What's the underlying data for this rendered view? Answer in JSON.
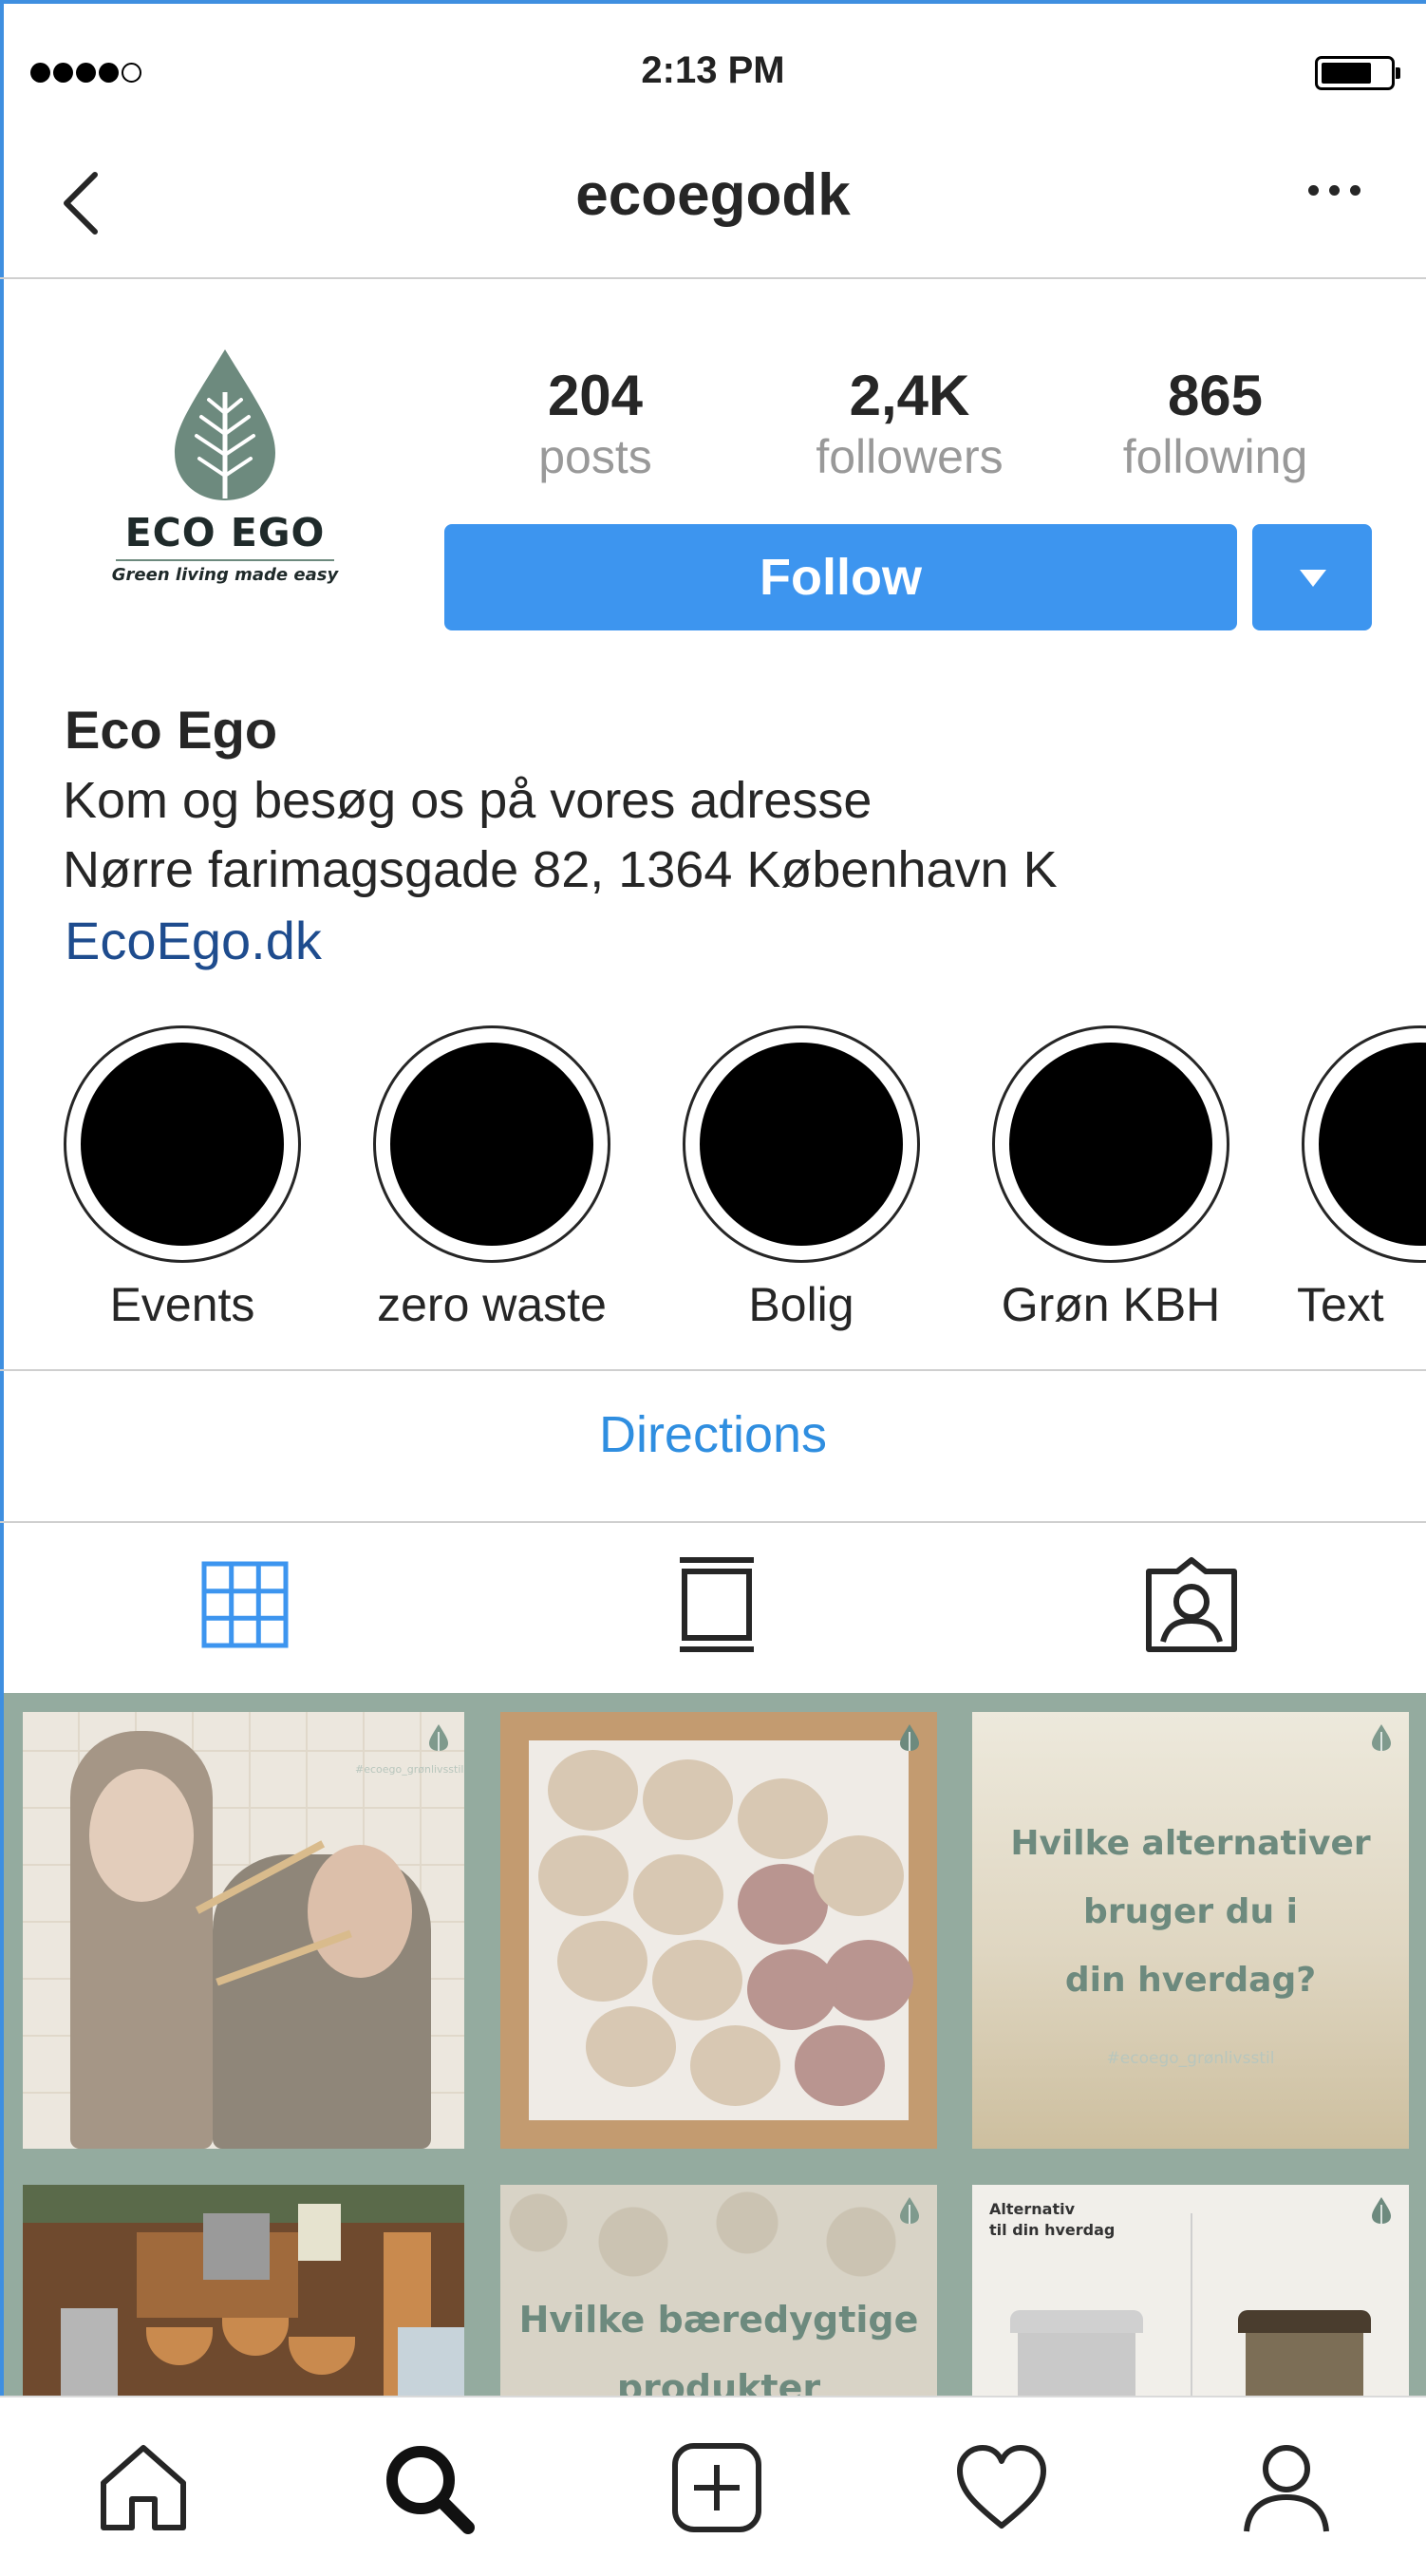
{
  "status_bar": {
    "time": "2:13 PM"
  },
  "nav": {
    "username": "ecoegodk"
  },
  "profile": {
    "logo_text": "ECO EGO",
    "logo_tagline": "Green living made easy",
    "stats": [
      {
        "value": "204",
        "label": "posts"
      },
      {
        "value": "2,4K",
        "label": "followers"
      },
      {
        "value": "865",
        "label": "following"
      }
    ],
    "follow_label": "Follow"
  },
  "bio": {
    "name": "Eco Ego",
    "lines": [
      "Kom og besøg os på vores adresse",
      "Nørre farimagsgade 82, 1364 København K"
    ],
    "link": "EcoEgo.dk"
  },
  "highlights": [
    {
      "label": "Events"
    },
    {
      "label": "zero waste"
    },
    {
      "label": "Bolig"
    },
    {
      "label": "Grøn KBH"
    },
    {
      "label": "Text"
    }
  ],
  "directions_label": "Directions",
  "tabs": {
    "grid": "grid-icon",
    "feed": "feed-icon",
    "tagged": "tagged-icon",
    "active": "grid"
  },
  "posts": {
    "p1_hashtag": "#ecoego_grønlivsstil",
    "p3_lines": [
      "Hvilke alternativer",
      "bruger du i",
      "din hverdag?"
    ],
    "p3_hashtag": "#ecoego_grønlivsstil",
    "p5_lines": [
      "Hvilke bæredygtige",
      "produkter"
    ],
    "p6_lines": [
      "Alternativ",
      "til din hverdag"
    ]
  },
  "colors": {
    "accent": "#3d95ef",
    "link": "#1e4c8e",
    "grid_bg": "#94ab9f",
    "brand_green": "#6d8a7e"
  }
}
